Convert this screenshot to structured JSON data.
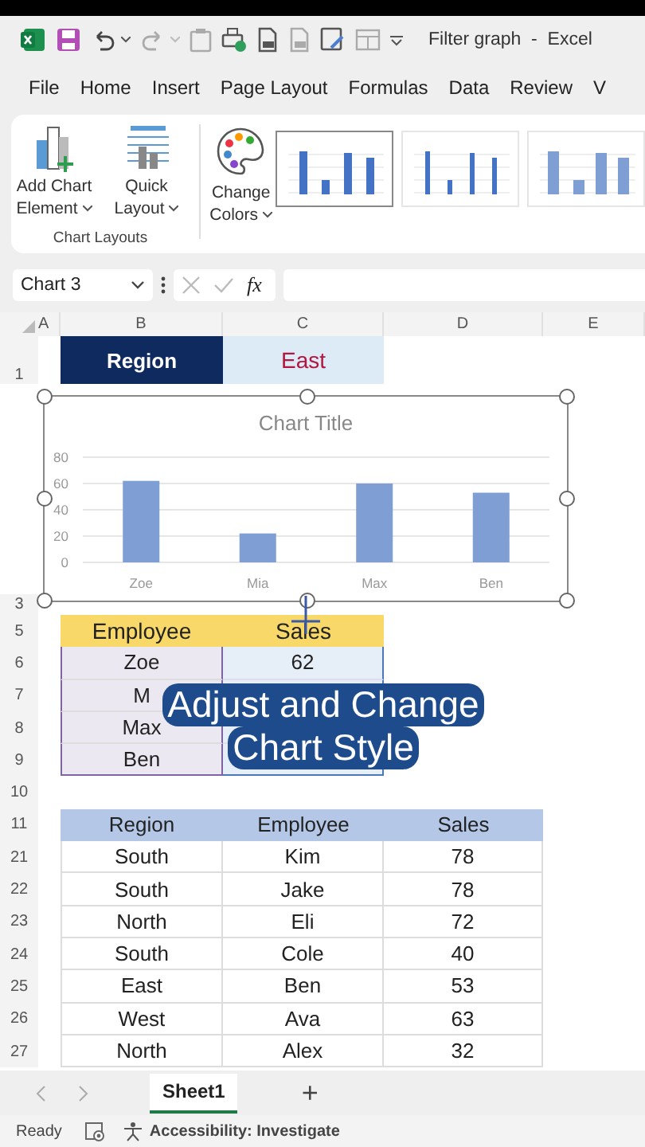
{
  "title_bar": {
    "title": "Filter graph  -  Excel"
  },
  "menu": [
    "File",
    "Home",
    "Insert",
    "Page Layout",
    "Formulas",
    "Data",
    "Review",
    "V"
  ],
  "ribbon": {
    "buttons": [
      {
        "kind": "add",
        "label": "Add Chart Element"
      },
      {
        "kind": "layout",
        "label": "Quick Layout"
      },
      {
        "kind": "colors",
        "label": "Change Colors"
      }
    ],
    "group_caption": "Chart Layouts",
    "styles": [
      {
        "selected": true,
        "kind": "plain"
      },
      {
        "selected": false,
        "kind": "thin"
      },
      {
        "selected": false,
        "kind": "striped"
      }
    ]
  },
  "name_box": "Chart 3",
  "formula_bar": {
    "fx": "fx"
  },
  "columns": [
    "A",
    "B",
    "C",
    "D",
    "E"
  ],
  "region_row": {
    "row": "1",
    "label": "Region",
    "value": "East"
  },
  "chart_row": "3",
  "chart": {
    "chart_data": {
      "type": "bar",
      "title": "Chart Title",
      "categories": [
        "Zoe",
        "Mia",
        "Max",
        "Ben"
      ],
      "series": [
        {
          "color": "#7f9fd4",
          "values": [
            62,
            22,
            60,
            53
          ]
        }
      ],
      "ylim": [
        0,
        80
      ],
      "yticks": [
        0,
        20,
        40,
        60,
        80
      ],
      "grid": true
    }
  },
  "employee_table": {
    "header_row": "5",
    "columns": [
      "Employee",
      "Sales"
    ],
    "rows": [
      {
        "row": "6",
        "employee": "Zoe",
        "sales": "62"
      },
      {
        "row": "7",
        "employee": "M"
      },
      {
        "row": "8",
        "employee": "Max"
      },
      {
        "row": "9",
        "employee": "Ben"
      }
    ]
  },
  "blank_row": "10",
  "region_table": {
    "header_row": "11",
    "columns": [
      "Region",
      "Employee",
      "Sales"
    ],
    "rows": [
      {
        "row": "21",
        "cells": [
          "South",
          "Kim",
          "78"
        ]
      },
      {
        "row": "22",
        "cells": [
          "South",
          "Jake",
          "78"
        ]
      },
      {
        "row": "23",
        "cells": [
          "North",
          "Eli",
          "72"
        ]
      },
      {
        "row": "24",
        "cells": [
          "South",
          "Cole",
          "40"
        ]
      },
      {
        "row": "25",
        "cells": [
          "East",
          "Ben",
          "53"
        ]
      },
      {
        "row": "26",
        "cells": [
          "West",
          "Ava",
          "63"
        ]
      },
      {
        "row": "27",
        "cells": [
          "North",
          "Alex",
          "32"
        ]
      }
    ]
  },
  "caption": [
    "Adjust and Change",
    "Chart Style"
  ],
  "sheet_tabs": [
    {
      "label": "Sheet1",
      "selected": true
    }
  ],
  "add_sheet": "+",
  "status_bar": {
    "ready": "Ready",
    "accessibility": "Accessibility: Investigate"
  }
}
